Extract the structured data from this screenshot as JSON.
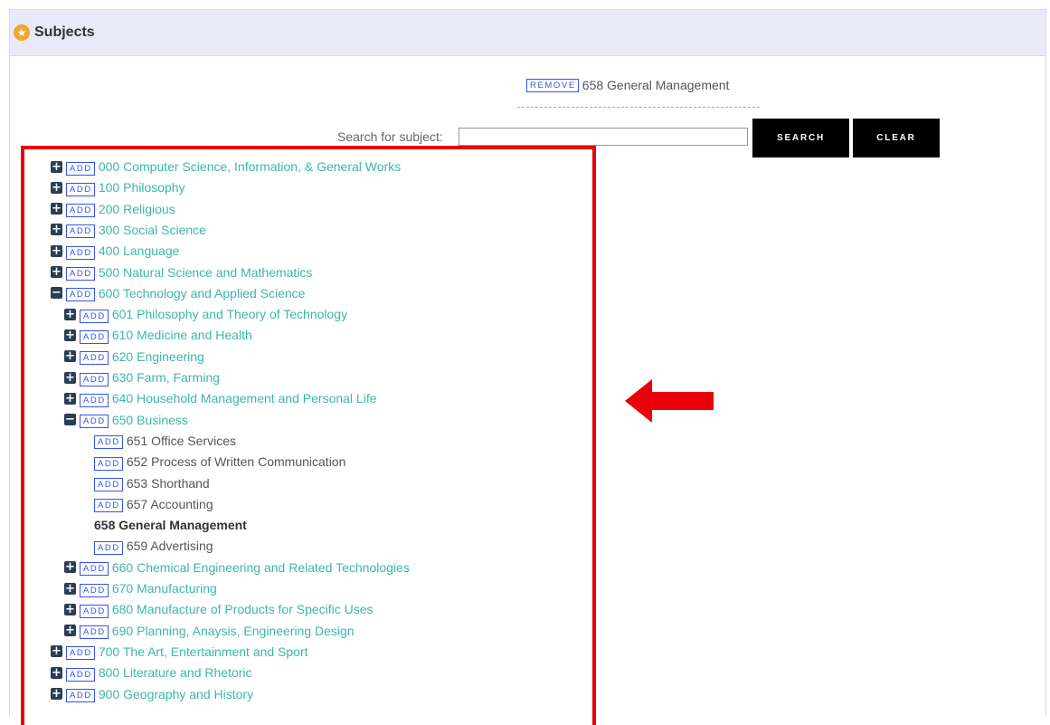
{
  "panel": {
    "title": "Subjects",
    "icon": "star-icon"
  },
  "selected": {
    "remove_label": "REMOVE",
    "subject": "658 General Management"
  },
  "search": {
    "label": "Search for subject:",
    "value": "",
    "search_label": "SEARCH",
    "clear_label": "CLEAR"
  },
  "tree": {
    "add_label": "ADD",
    "items": [
      {
        "label": "000 Computer Science, Information, & General Works",
        "level": 0,
        "toggle": "plus",
        "style": "link"
      },
      {
        "label": "100 Philosophy",
        "level": 0,
        "toggle": "plus",
        "style": "link"
      },
      {
        "label": "200 Religious",
        "level": 0,
        "toggle": "plus",
        "style": "link"
      },
      {
        "label": "300 Social Science",
        "level": 0,
        "toggle": "plus",
        "style": "link"
      },
      {
        "label": "400 Language",
        "level": 0,
        "toggle": "plus",
        "style": "link"
      },
      {
        "label": "500 Natural Science and Mathematics",
        "level": 0,
        "toggle": "plus",
        "style": "link"
      },
      {
        "label": "600 Technology and Applied Science",
        "level": 0,
        "toggle": "minus",
        "style": "link"
      },
      {
        "label": "601 Philosophy and Theory of Technology",
        "level": 1,
        "toggle": "plus",
        "style": "link"
      },
      {
        "label": "610 Medicine and Health",
        "level": 1,
        "toggle": "plus",
        "style": "link"
      },
      {
        "label": "620 Engineering",
        "level": 1,
        "toggle": "plus",
        "style": "link"
      },
      {
        "label": "630 Farm, Farming",
        "level": 1,
        "toggle": "plus",
        "style": "link"
      },
      {
        "label": "640 Household Management and Personal Life",
        "level": 1,
        "toggle": "plus",
        "style": "link"
      },
      {
        "label": "650 Business",
        "level": 1,
        "toggle": "minus",
        "style": "link"
      },
      {
        "label": "651 Office Services",
        "level": 2,
        "toggle": "none",
        "style": "leaf"
      },
      {
        "label": "652 Process of Written Communication",
        "level": 2,
        "toggle": "none",
        "style": "leaf"
      },
      {
        "label": "653 Shorthand",
        "level": 2,
        "toggle": "none",
        "style": "leaf"
      },
      {
        "label": "657 Accounting",
        "level": 2,
        "toggle": "none",
        "style": "leaf"
      },
      {
        "label": "658 General Management",
        "level": 2,
        "toggle": "none",
        "style": "selected"
      },
      {
        "label": "659 Advertising",
        "level": 2,
        "toggle": "none",
        "style": "leaf"
      },
      {
        "label": "660 Chemical Engineering and Related Technologies",
        "level": 1,
        "toggle": "plus",
        "style": "link"
      },
      {
        "label": "670 Manufacturing",
        "level": 1,
        "toggle": "plus",
        "style": "link"
      },
      {
        "label": "680 Manufacture of Products for Specific Uses",
        "level": 1,
        "toggle": "plus",
        "style": "link"
      },
      {
        "label": "690 Planning, Anaysis, Engineering Design",
        "level": 1,
        "toggle": "plus",
        "style": "link"
      },
      {
        "label": "700 The Art, Entertainment and Sport",
        "level": 0,
        "toggle": "plus",
        "style": "link"
      },
      {
        "label": "800 Literature and Rhetoric",
        "level": 0,
        "toggle": "plus",
        "style": "link"
      },
      {
        "label": "900 Geography and History",
        "level": 0,
        "toggle": "plus",
        "style": "link"
      }
    ]
  },
  "colors": {
    "link": "#3bb8a6",
    "tag_border": "#3355ee",
    "highlight": "#e8000a",
    "header_bg": "#e9e9f9"
  }
}
